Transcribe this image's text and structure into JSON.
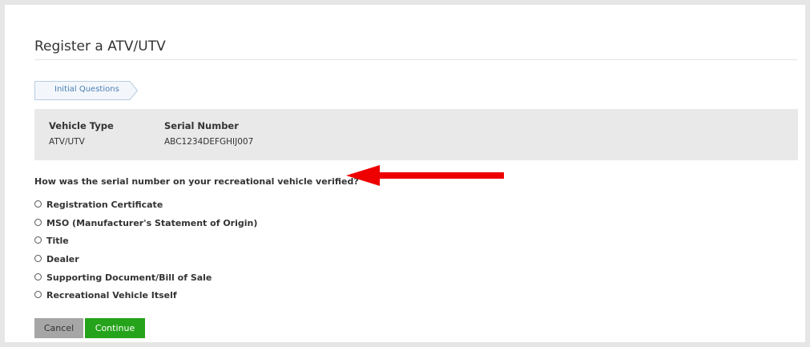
{
  "page": {
    "title": "Register a ATV/UTV"
  },
  "breadcrumb": {
    "steps": [
      {
        "label": "Initial Questions"
      }
    ]
  },
  "vehicle_info": {
    "vehicle_type_label": "Vehicle Type",
    "vehicle_type_value": "ATV/UTV",
    "serial_number_label": "Serial Number",
    "serial_number_value": "ABC1234DEFGHIJ007"
  },
  "question": {
    "text": "How was the serial number on your recreational vehicle verified?",
    "options": [
      {
        "label": "Registration Certificate",
        "selected": false
      },
      {
        "label": "MSO (Manufacturer's Statement of Origin)",
        "selected": false
      },
      {
        "label": "Title",
        "selected": false
      },
      {
        "label": "Dealer",
        "selected": false
      },
      {
        "label": "Supporting Document/Bill of Sale",
        "selected": false
      },
      {
        "label": "Recreational Vehicle Itself",
        "selected": false
      }
    ]
  },
  "actions": {
    "cancel_label": "Cancel",
    "continue_label": "Continue"
  },
  "annotation": {
    "arrow_icon": "red-left-arrow-icon",
    "arrow_color": "#ee0000"
  },
  "colors": {
    "continue_button": "#25a31a",
    "cancel_button": "#a6a6a6",
    "breadcrumb_text": "#4a7fb5",
    "info_panel_bg": "#e9e9e9"
  }
}
